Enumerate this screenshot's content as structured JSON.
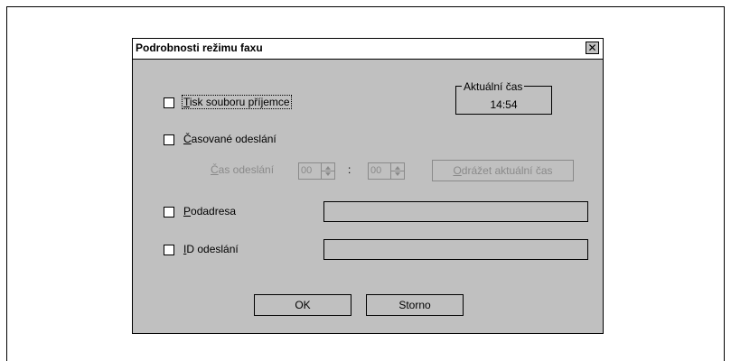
{
  "dialog": {
    "title": "Podrobnosti režimu faxu",
    "close_glyph": "✕"
  },
  "print_receiver_file": {
    "label": "Tisk souboru příjemce",
    "accel": "T",
    "label_rest": "isk souboru příjemce",
    "checked": false
  },
  "current_time": {
    "caption": "Aktuální čas",
    "value": "14:54"
  },
  "timed_send": {
    "label": "Časované odeslání",
    "accel": "Č",
    "label_rest": "asované odeslání",
    "checked": false
  },
  "send_time": {
    "label": "Čas odeslání",
    "accel": "Č",
    "label_rest": "as odeslání",
    "hours": "00",
    "separator": ":",
    "minutes": "00",
    "reflect_button_label": "Odrážet aktuální čas",
    "reflect_accel": "O",
    "reflect_rest": "drážet aktuální čas"
  },
  "subaddress": {
    "label": "Podadresa",
    "accel": "P",
    "label_rest": "odadresa",
    "checked": false,
    "value": ""
  },
  "send_id": {
    "label": "ID odeslání",
    "accel": "I",
    "label_rest": "D odeslání",
    "checked": false,
    "value": ""
  },
  "buttons": {
    "ok_label": "OK",
    "cancel_label": "Storno"
  }
}
